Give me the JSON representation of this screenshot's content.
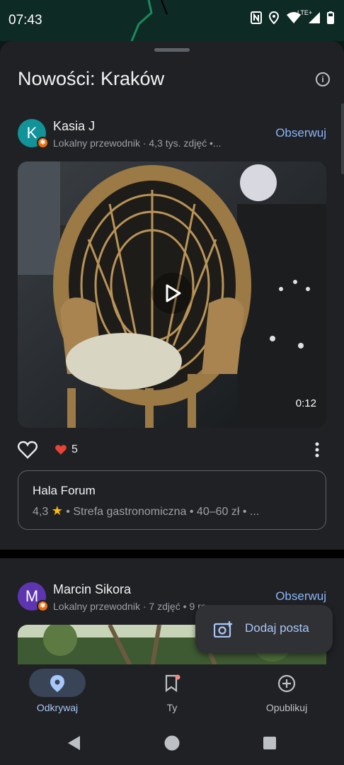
{
  "status_bar": {
    "time": "07:43",
    "network_label": "LTE+",
    "icons": [
      "nfc-icon",
      "location-icon",
      "wifi-icon",
      "signal-icon",
      "battery-icon"
    ]
  },
  "sheet": {
    "title": "Nowości: Kraków",
    "info_icon": "info-icon"
  },
  "posts": [
    {
      "author": "Kasia J",
      "avatar_letter": "K",
      "avatar_color": "#12939a",
      "meta": "Lokalny przewodnik · 4,3 tys. zdjęć  •...",
      "follow_label": "Obserwuj",
      "video_duration": "0:12",
      "likes": "5",
      "place": {
        "name": "Hala Forum",
        "rating": "4,3",
        "category": "Strefa gastronomiczna",
        "price": "40–60 zł",
        "more": "..."
      }
    },
    {
      "author": "Marcin Sikora",
      "avatar_letter": "M",
      "avatar_color": "#5e35b1",
      "meta": "Lokalny przewodnik · 7 zdjęć  •  9 ro",
      "follow_label": "Obserwuj"
    }
  ],
  "fab": {
    "label": "Dodaj posta",
    "icon": "add-photo-icon"
  },
  "bottom_nav": [
    {
      "label": "Odkrywaj",
      "icon": "location-pin-icon",
      "active": true
    },
    {
      "label": "Ty",
      "icon": "bookmark-icon",
      "active": false
    },
    {
      "label": "Opublikuj",
      "icon": "add-circle-icon",
      "active": false
    }
  ],
  "colors": {
    "accent": "#8ab4f8",
    "active_pill": "#394457",
    "badge": "#e8710a",
    "heart": "#ea4335",
    "star": "#fbbc04"
  }
}
